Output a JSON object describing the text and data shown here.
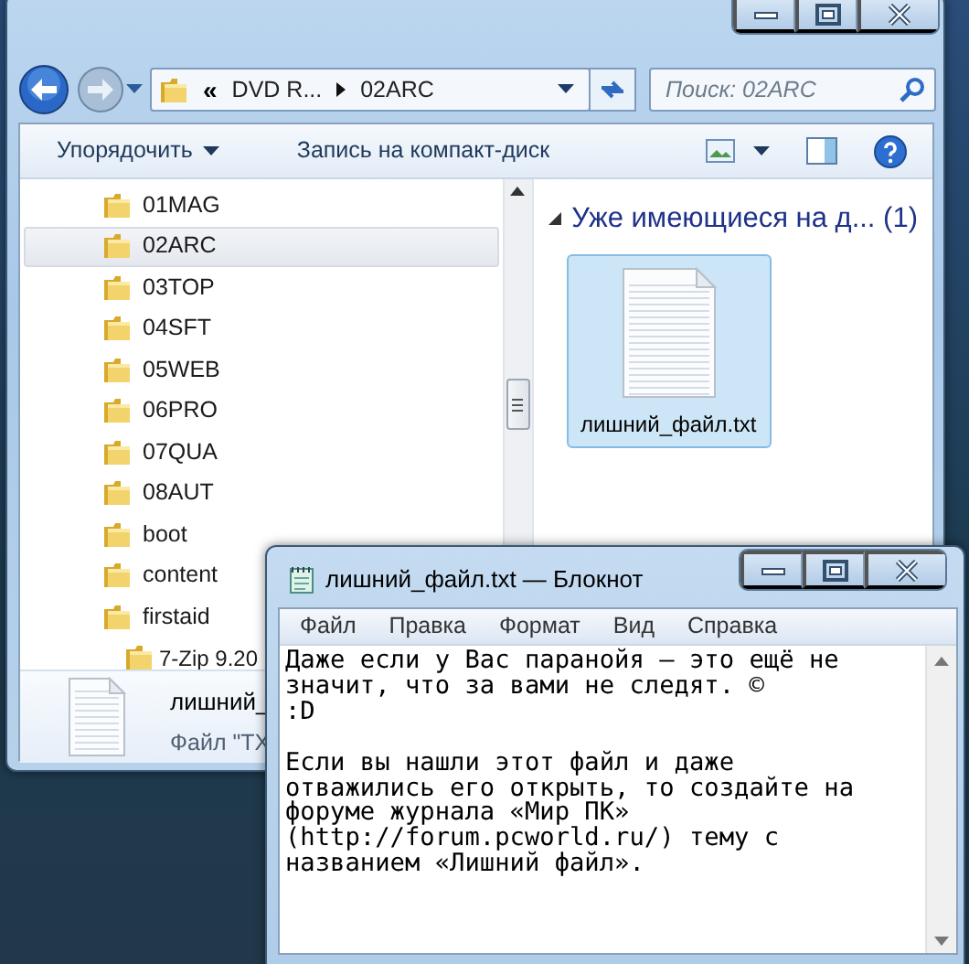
{
  "explorer": {
    "address": {
      "overflow_mark": "«",
      "crumbs": [
        "DVD R...",
        "02ARC"
      ]
    },
    "search": {
      "placeholder": "Поиск: 02ARC"
    },
    "toolbar": [
      {
        "label": "Упорядочить",
        "dropdown": true
      },
      {
        "label": "Запись на компакт-диск",
        "dropdown": false
      }
    ],
    "tree": [
      {
        "label": "01MAG",
        "selected": false
      },
      {
        "label": "02ARC",
        "selected": true
      },
      {
        "label": "03TOP",
        "selected": false
      },
      {
        "label": "04SFT",
        "selected": false
      },
      {
        "label": "05WEB",
        "selected": false
      },
      {
        "label": "06PRO",
        "selected": false
      },
      {
        "label": "07QUA",
        "selected": false
      },
      {
        "label": "08AUT",
        "selected": false
      },
      {
        "label": "boot",
        "selected": false
      },
      {
        "label": "content",
        "selected": false
      },
      {
        "label": "firstaid",
        "selected": false,
        "children": [
          {
            "label": "7-Zip 9.20",
            "selected": false
          }
        ]
      }
    ],
    "group": {
      "title": "Уже имеющиеся на д... (1)",
      "expanded": true
    },
    "files": [
      {
        "name": "лишний_файл.txt",
        "selected": true
      }
    ],
    "details": {
      "name": "лишний_",
      "type": "Файл \"TX"
    }
  },
  "notepad": {
    "title": "лишний_файл.txt — Блокнот",
    "menu": [
      "Файл",
      "Правка",
      "Формат",
      "Вид",
      "Справка"
    ],
    "text": "Даже если у Вас паранойя – это ещё не\nзначит, что за вами не следят. ©\n:D\n\nЕсли вы нашли этот файл и даже\nотважились его открыть, то создайте на\nфоруме журнала «Мир ПК»\n(http://forum.pcworld.ru/) тему с\nназванием «Лишний файл»."
  }
}
